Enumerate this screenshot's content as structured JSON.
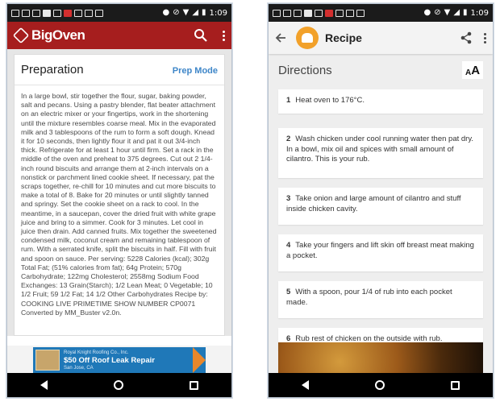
{
  "status_bar": {
    "time": "1:09"
  },
  "left_app": {
    "brand": "BigOven",
    "section_title": "Preparation",
    "prep_mode_label": "Prep Mode",
    "preparation_text": "In a large bowl, stir together the flour, sugar, baking powder, salt and  pecans. Using a pastry blender, flat beater attachment on an electric mixer  or your fingertips, work in the shortening until the mixture resembles  coarse meal. Mix in the evaporated milk and 3 tablespoons of the rum to  form a soft dough. Knead it for 10 seconds, then lightly flour it and pat  it out 3/4-inch thick. Refrigerate for at least 1 hour until firm.    Set a rack in the middle of the oven and preheat to 375 degrees.    Cut out 2 1/4-inch round biscuits and arrange them at 2-inch intervals on a nonstick or parchment lined cookie sheet. If necessary, pat the scraps  together, re-chill for 10 minutes and cut more biscuits to make a total of  8.    Bake for 20 minutes or until slightly tanned and springy. Set the cookie  sheet on a rack to cool.    In the meantime, in a saucepan, cover the dried fruit with white grape  juice and bring to a simmer. Cook for 3 minutes. Let cool in juice then drain. Add canned fruits.    Mix together the sweetened condensed milk, coconut cream and remaining  tablespoon of rum. With a serrated knife, split the biscuits in half. Fill with fruit and  spoon on sauce.      Per serving: 5228 Calories (kcal); 302g Total Fat; (51% calories from fat);  64g Protein; 570g Carbohydrate; 122mg Cholesterol; 2558mg Sodium Food  Exchanges: 13 Grain(Starch); 1/2 Lean Meat; 0 Vegetable; 10 1/2 Fruit; 59  1/2 Fat; 14 1/2 Other Carbohydrates    Recipe by: COOKING LIVE PRIMETIME SHOW NUMBER CP0071      Converted by MM_Buster v2.0n.",
    "ad": {
      "company": "Royal Knight Roofing Co., Inc.",
      "headline": "$50 Off Roof Leak Repair",
      "location": "San Jose, CA"
    }
  },
  "right_app": {
    "title": "Recipe",
    "section_title": "Directions",
    "text_size_small": "A",
    "text_size_large": "A",
    "steps": [
      {
        "num": "1",
        "text": "Heat oven to 176°C."
      },
      {
        "num": "2",
        "text": "Wash chicken under cool running water then pat dry. In a bowl, mix oil and spices with small amount of cilantro. This is your rub."
      },
      {
        "num": "3",
        "text": "Take onion and large amount of cilantro and stuff inside chicken cavity."
      },
      {
        "num": "4",
        "text": "Take your fingers and lift skin off breast meat making a pocket."
      },
      {
        "num": "5",
        "text": "With a spoon, pour 1/4 of rub into each pocket made."
      },
      {
        "num": "6",
        "text": "Rub rest of chicken on the outside with rub."
      }
    ]
  },
  "colors": {
    "bigoven_red": "#a61e1e",
    "link_blue": "#3e86c8",
    "hat_orange": "#f2a12a"
  },
  "icons": [
    "back-arrow-icon",
    "search-icon",
    "menu-dots-icon",
    "share-icon",
    "chef-hat-icon",
    "text-size-icon",
    "nav-back-icon",
    "nav-home-icon",
    "nav-recent-icon"
  ]
}
